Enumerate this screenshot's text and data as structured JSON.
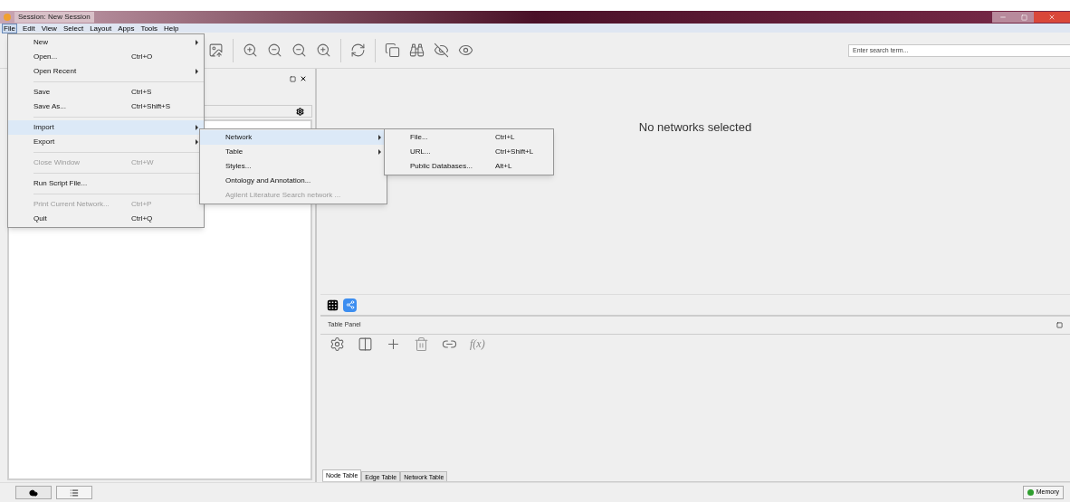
{
  "window": {
    "title": "Session: New Session"
  },
  "menubar": [
    {
      "label": "File",
      "selected": true
    },
    {
      "label": "Edit",
      "selected": false
    },
    {
      "label": "View",
      "selected": false
    },
    {
      "label": "Select",
      "selected": false
    },
    {
      "label": "Layout",
      "selected": false
    },
    {
      "label": "Apps",
      "selected": false
    },
    {
      "label": "Tools",
      "selected": false
    },
    {
      "label": "Help",
      "selected": false
    }
  ],
  "search": {
    "placeholder": "Enter search term..."
  },
  "network_view": {
    "message": "No networks selected"
  },
  "view_switch": [
    {
      "selected": false
    },
    {
      "selected": true
    }
  ],
  "table_panel": {
    "title": "Table Panel",
    "formula": "f(x)",
    "tabs": [
      {
        "label": "Node Table",
        "selected": true
      },
      {
        "label": "Edge Table",
        "selected": false
      },
      {
        "label": "Network Table",
        "selected": false
      }
    ]
  },
  "status_bar": {
    "memory": "Memory"
  },
  "file_menu": [
    {
      "kind": "item",
      "label": "New",
      "submenu": true,
      "disabled": false,
      "selected": false
    },
    {
      "kind": "item",
      "label": "Open...",
      "shortcut": "Ctrl+O",
      "submenu": false,
      "disabled": false,
      "selected": false
    },
    {
      "kind": "item",
      "label": "Open Recent",
      "submenu": true,
      "disabled": false,
      "selected": false
    },
    {
      "kind": "separator"
    },
    {
      "kind": "item",
      "label": "Save",
      "shortcut": "Ctrl+S",
      "submenu": false,
      "disabled": false,
      "selected": false
    },
    {
      "kind": "item",
      "label": "Save As...",
      "shortcut": "Ctrl+Shift+S",
      "submenu": false,
      "disabled": false,
      "selected": false
    },
    {
      "kind": "separator"
    },
    {
      "kind": "item",
      "label": "Import",
      "submenu": true,
      "disabled": false,
      "selected": true
    },
    {
      "kind": "item",
      "label": "Export",
      "submenu": true,
      "disabled": false,
      "selected": false
    },
    {
      "kind": "separator"
    },
    {
      "kind": "item",
      "label": "Close Window",
      "shortcut": "Ctrl+W",
      "submenu": false,
      "disabled": true,
      "selected": false
    },
    {
      "kind": "separator"
    },
    {
      "kind": "item",
      "label": "Run Script File...",
      "submenu": false,
      "disabled": false,
      "selected": false
    },
    {
      "kind": "separator"
    },
    {
      "kind": "item",
      "label": "Print Current Network...",
      "shortcut": "Ctrl+P",
      "submenu": false,
      "disabled": true,
      "selected": false
    },
    {
      "kind": "item",
      "label": "Quit",
      "shortcut": "Ctrl+Q",
      "submenu": false,
      "disabled": false,
      "selected": false
    }
  ],
  "import_menu": [
    {
      "kind": "item",
      "label": "Network",
      "submenu": true,
      "disabled": false,
      "selected": true
    },
    {
      "kind": "item",
      "label": "Table",
      "submenu": true,
      "disabled": false,
      "selected": false
    },
    {
      "kind": "item",
      "label": "Styles...",
      "submenu": false,
      "disabled": false,
      "selected": false
    },
    {
      "kind": "item",
      "label": "Ontology and Annotation...",
      "submenu": false,
      "disabled": false,
      "selected": false
    },
    {
      "kind": "item",
      "label": "Agilent Literature Search network ...",
      "submenu": false,
      "disabled": true,
      "selected": false
    }
  ],
  "network_menu": [
    {
      "kind": "item",
      "label": "File...",
      "shortcut": "Ctrl+L",
      "submenu": false,
      "disabled": false,
      "selected": false
    },
    {
      "kind": "item",
      "label": "URL...",
      "shortcut": "Ctrl+Shift+L",
      "submenu": false,
      "disabled": false,
      "selected": false
    },
    {
      "kind": "item",
      "label": "Public Databases...",
      "shortcut": "Alt+L",
      "submenu": false,
      "disabled": false,
      "selected": false
    }
  ]
}
